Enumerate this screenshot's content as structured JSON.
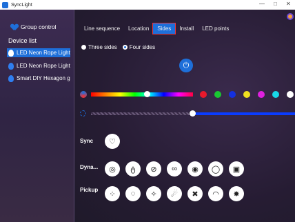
{
  "window": {
    "title": "SyncLight",
    "minimize": "—",
    "maximize": "□",
    "close": "✕"
  },
  "sidebar": {
    "group_control": "Group control",
    "device_list_heading": "Device list",
    "devices": [
      {
        "label": "LED Neon Rope Light",
        "selected": true
      },
      {
        "label": "LED Neon Rope Light",
        "selected": false
      },
      {
        "label": "Smart DIY Hexagon g",
        "selected": false
      }
    ]
  },
  "tabs": [
    {
      "label": "Line sequence",
      "active": false
    },
    {
      "label": "Location",
      "active": false
    },
    {
      "label": "Sides",
      "active": true
    },
    {
      "label": "Install",
      "active": false
    },
    {
      "label": "LED points",
      "active": false
    }
  ],
  "sides": {
    "options": [
      {
        "label": "Three sides",
        "selected": false
      },
      {
        "label": "Four sides",
        "selected": true
      }
    ]
  },
  "power_icon": "⏻",
  "color": {
    "position": 0.55,
    "swatches": [
      "#e8192c",
      "#19c832",
      "#1430e0",
      "#f0e020",
      "#e020e0",
      "#18d8e8",
      "#ffffff"
    ]
  },
  "brightness": {
    "level": 0.5
  },
  "effects": {
    "sync": {
      "label": "Sync",
      "icons": [
        "heartbeat-icon"
      ]
    },
    "dynamic": {
      "label": "Dyna...",
      "icons": [
        "target-icon",
        "apple-icon",
        "swirl-icon",
        "infinity-icon",
        "eye-icon",
        "blob-icon",
        "image-icon"
      ]
    },
    "pickup": {
      "label": "Pickup",
      "icons": [
        "dots-circle-icon",
        "ring-icon",
        "sparkle-icon",
        "meteor-icon",
        "cross-icon",
        "rainbow-icon",
        "burst-icon"
      ]
    }
  },
  "icon_glyphs": {
    "heartbeat-icon": "♡",
    "target-icon": "◎",
    "apple-icon": "ტ",
    "swirl-icon": "⊘",
    "infinity-icon": "∞",
    "eye-icon": "◉",
    "blob-icon": "◯",
    "image-icon": "▣",
    "dots-circle-icon": "⁘",
    "ring-icon": "◌",
    "sparkle-icon": "✧",
    "meteor-icon": "☄",
    "cross-icon": "✖",
    "rainbow-icon": "◠",
    "burst-icon": "✸"
  }
}
